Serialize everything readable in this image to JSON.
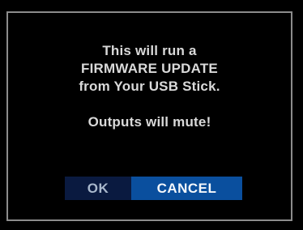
{
  "dialog": {
    "message_lines": [
      "This will run a",
      "FIRMWARE UPDATE",
      "from Your USB Stick."
    ],
    "warning": "Outputs will mute!"
  },
  "buttons": {
    "ok_label": "OK",
    "cancel_label": "CANCEL",
    "selected": "CANCEL"
  },
  "colors": {
    "background": "#000000",
    "border": "#8c8c8c",
    "text": "#d9d9d9",
    "ok_bg": "#0a1a40",
    "cancel_bg_selected": "#0a4f9e"
  }
}
